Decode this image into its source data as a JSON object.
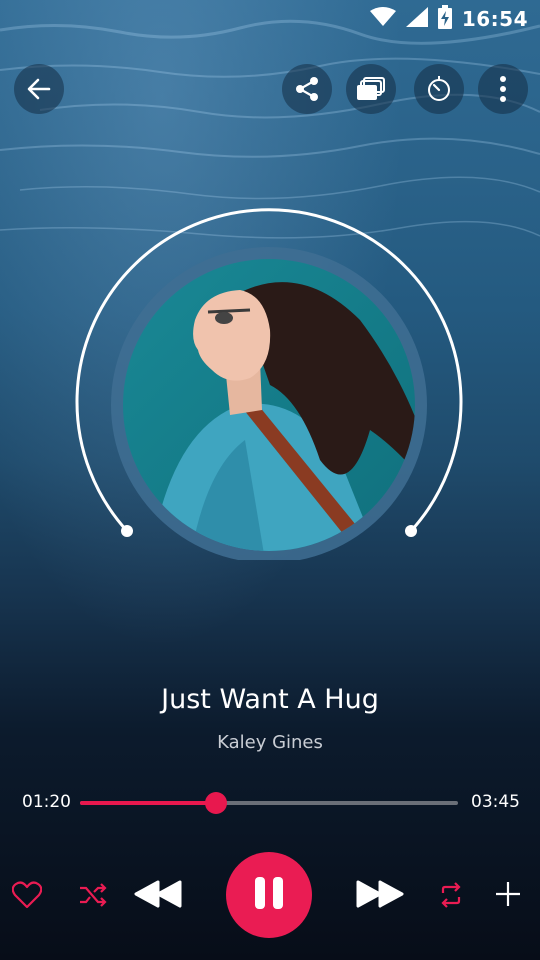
{
  "status_bar": {
    "time": "16:54",
    "icons": [
      "wifi-icon",
      "cell-signal-icon",
      "battery-charging-icon"
    ]
  },
  "top_bar": {
    "back_icon": "arrow-left-icon",
    "actions": [
      "share-icon",
      "queue-icon",
      "timer-icon",
      "more-vertical-icon"
    ]
  },
  "now_playing": {
    "title": "Just Want A Hug",
    "artist": "Kaley Gines",
    "elapsed": "01:20",
    "duration": "03:45",
    "progress_fraction": 0.36
  },
  "controls": {
    "icons": [
      "heart-icon",
      "shuffle-icon",
      "rewind-icon",
      "pause-icon",
      "fast-forward-icon",
      "repeat-icon",
      "plus-icon"
    ],
    "accent_color": "#ea1c53"
  }
}
